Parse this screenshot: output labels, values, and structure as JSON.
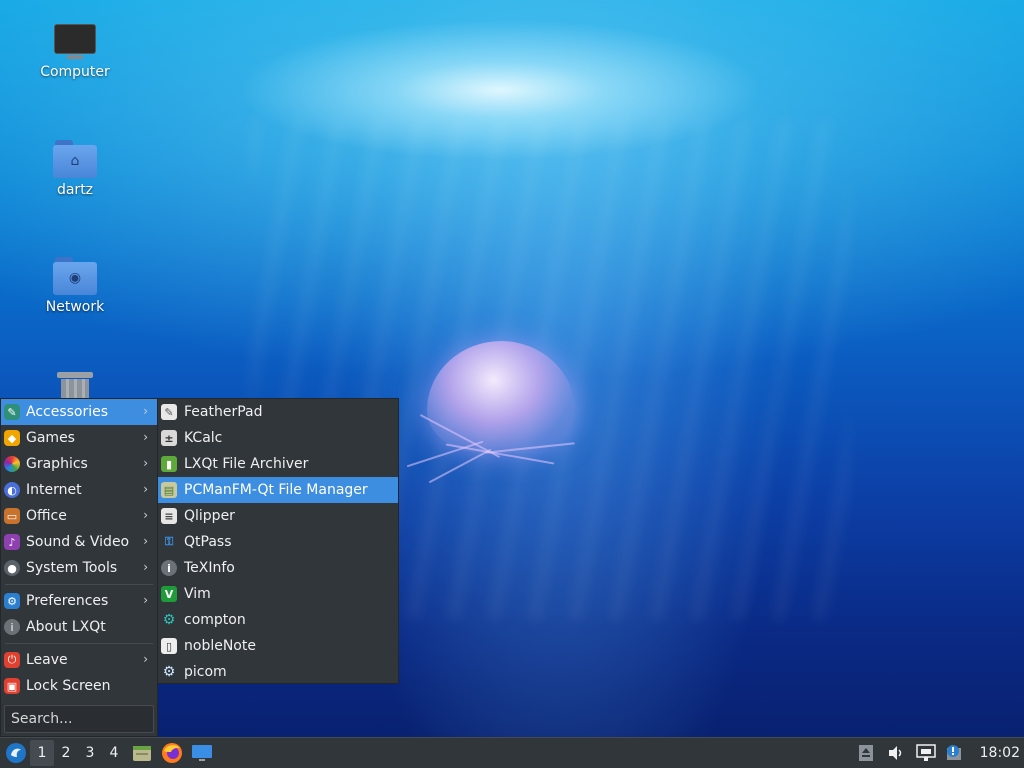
{
  "desktop": {
    "icons": [
      {
        "label": "Computer",
        "icon": "computer-icon"
      },
      {
        "label": "dartz",
        "icon": "home-folder-icon"
      },
      {
        "label": "Network",
        "icon": "network-folder-icon"
      },
      {
        "label": "",
        "icon": "trash-icon"
      }
    ]
  },
  "menu": {
    "items": [
      {
        "label": "Accessories",
        "icon": "accessories-icon",
        "has_submenu": true,
        "active": true
      },
      {
        "label": "Games",
        "icon": "games-icon",
        "has_submenu": true
      },
      {
        "label": "Graphics",
        "icon": "graphics-icon",
        "has_submenu": true
      },
      {
        "label": "Internet",
        "icon": "internet-icon",
        "has_submenu": true
      },
      {
        "label": "Office",
        "icon": "office-icon",
        "has_submenu": true
      },
      {
        "label": "Sound & Video",
        "icon": "sound-video-icon",
        "has_submenu": true
      },
      {
        "label": "System Tools",
        "icon": "system-tools-icon",
        "has_submenu": true
      },
      {
        "label": "Preferences",
        "icon": "preferences-icon",
        "has_submenu": true
      },
      {
        "label": "About LXQt",
        "icon": "about-icon",
        "has_submenu": false
      },
      {
        "label": "Leave",
        "icon": "leave-icon",
        "has_submenu": true
      },
      {
        "label": "Lock Screen",
        "icon": "lock-icon",
        "has_submenu": false
      }
    ],
    "search_placeholder": "Search..."
  },
  "submenu": {
    "items": [
      {
        "label": "FeatherPad",
        "icon": "featherpad-icon"
      },
      {
        "label": "KCalc",
        "icon": "kcalc-icon"
      },
      {
        "label": "LXQt File Archiver",
        "icon": "archiver-icon"
      },
      {
        "label": "PCManFM-Qt File Manager",
        "icon": "file-manager-icon",
        "active": true
      },
      {
        "label": "Qlipper",
        "icon": "qlipper-icon"
      },
      {
        "label": "QtPass",
        "icon": "qtpass-icon"
      },
      {
        "label": "TeXInfo",
        "icon": "texinfo-icon"
      },
      {
        "label": "Vim",
        "icon": "vim-icon"
      },
      {
        "label": "compton",
        "icon": "compton-icon"
      },
      {
        "label": "nobleNote",
        "icon": "noblenote-icon"
      },
      {
        "label": "picom",
        "icon": "picom-icon"
      }
    ]
  },
  "taskbar": {
    "workspaces": [
      "1",
      "2",
      "3",
      "4"
    ],
    "active_workspace": "1",
    "launchers": [
      "file-manager-icon",
      "firefox-icon",
      "desktop-icon"
    ],
    "clock": "18:02"
  },
  "colors": {
    "menu_bg": "#31363b",
    "highlight": "#3d8ee0",
    "text": "#eff0f1"
  }
}
